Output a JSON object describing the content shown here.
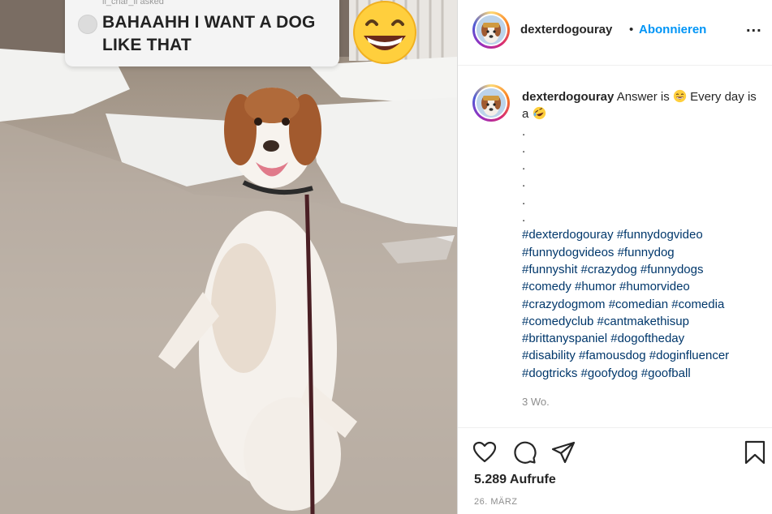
{
  "media": {
    "question_asker": "li_char_li asked",
    "question_text": "BAHAAHH I WANT A DOG LIKE THAT",
    "sticker_icon": "grinning-face-icon"
  },
  "header": {
    "username": "dexterdogouray",
    "separator": "•",
    "follow_label": "Abonnieren",
    "more_label": "..."
  },
  "caption": {
    "username": "dexterdogouray",
    "text_before": "Answer is",
    "text_middle": "Every day is a",
    "emoji_1": "grinning-face-icon",
    "emoji_2": "rofl-face-icon",
    "dots": [
      ".",
      ".",
      ".",
      ".",
      ".",
      "."
    ],
    "hashtag_lines": [
      "#dexterdogouray #funnydogvideo",
      "#funnydogvideos #funnydog",
      "#funnyshit #crazydog #funnydogs",
      "#comedy #humor #humorvideo",
      "#crazydogmom #comedian #comedia",
      "#comedyclub #cantmakethisup",
      "#brittanyspaniel #dogoftheday",
      "#disability #famousdog #doginfluencer",
      "#dogtricks #goofydog #goofball"
    ]
  },
  "meta": {
    "time_ago": "3 Wo.",
    "views": "5.289 Aufrufe",
    "date": "26. MÄRZ"
  },
  "colors": {
    "link": "#0095f6",
    "hashtag": "#00376b",
    "muted": "#8e8e8e"
  }
}
